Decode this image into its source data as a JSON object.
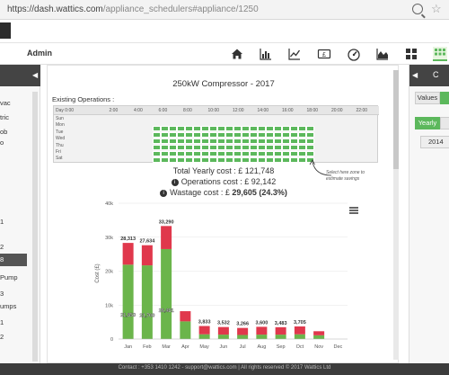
{
  "browser": {
    "url_host": "https://dash.wattics.com",
    "url_path": "/appliance_schedulers#appliance/1250"
  },
  "nav": {
    "user": "Admin",
    "icons": [
      "home-icon",
      "bar-chart-icon",
      "line-chart-icon",
      "currency-icon",
      "gauge-icon",
      "area-chart-icon",
      "grid-icon",
      "scheduler-icon"
    ]
  },
  "sidebar": {
    "items": [
      "vac",
      "tric",
      "ob",
      "o",
      "1",
      "2",
      "Pump",
      "3",
      "umps",
      "1",
      "2"
    ],
    "selected": "8"
  },
  "main": {
    "title": "250kW Compressor - 2017",
    "existing_label": "Existing Operations :",
    "schedule": {
      "hours": [
        "Day 0:00",
        "2:00",
        "4:00",
        "6:00",
        "8:00",
        "10:00",
        "12:00",
        "14:00",
        "16:00",
        "18:00",
        "20:00",
        "22:00"
      ],
      "days": [
        "Sun",
        "Mon",
        "Tue",
        "Wed",
        "Thu",
        "Fri",
        "Sat"
      ]
    },
    "costs": {
      "total": "Total Yearly cost : £ 121,748",
      "operations": "Operations cost : £ 92,142",
      "wastage_prefix": "Wastage cost : £ ",
      "wastage_value": "29,605 (24.3%)"
    },
    "annotation": [
      "Select here zone to",
      "estimate savings"
    ]
  },
  "chart_data": {
    "type": "bar",
    "stacked": true,
    "categories": [
      "Jan",
      "Feb",
      "Mar",
      "Apr",
      "May",
      "Jun",
      "Jul",
      "Aug",
      "Sep",
      "Oct",
      "Nov",
      "Dec"
    ],
    "totals": [
      "28,313",
      "27,634",
      "33,290",
      "",
      "3,833",
      "3,532",
      "3,266",
      "3,600",
      "3,483",
      "3,705",
      "",
      ""
    ],
    "series": [
      {
        "values": [
          21900,
          21700,
          26500,
          5200,
          1400,
          1300,
          1200,
          1300,
          1300,
          1400,
          1100,
          0
        ],
        "color": "#6bb54b"
      },
      {
        "values": [
          6413,
          5934,
          6790,
          3000,
          2433,
          2232,
          2066,
          2300,
          2183,
          2305,
          1200,
          0
        ],
        "color": "#e0384c"
      }
    ],
    "inner_labels": [
      "21,850",
      "21,700",
      "26,481",
      "",
      "",
      "",
      "",
      "",
      "",
      "",
      "",
      ""
    ],
    "ylabel": "Cost (£)",
    "yticks": [
      "0",
      "10k",
      "20k",
      "30k",
      "40k"
    ],
    "ylim": [
      0,
      40000
    ],
    "menu_icon": "hamburger-icon"
  },
  "right_panel": {
    "head_label": "C",
    "values_label": "Values",
    "period_label": "Yearly",
    "year": "2014"
  },
  "footer": {
    "text": "Contact : +353 1410 1242 - support@wattics.com | All rights reserved © 2017 Wattics Ltd"
  }
}
